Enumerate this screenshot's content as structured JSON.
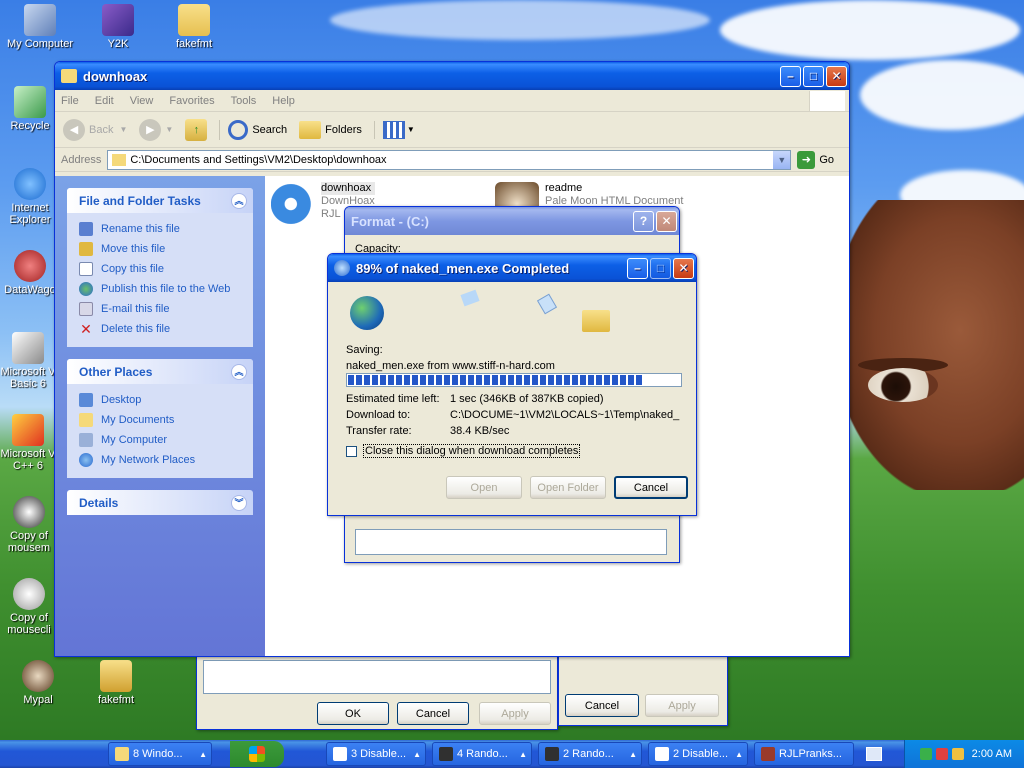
{
  "desktop": {
    "icons": [
      {
        "label": "My Computer"
      },
      {
        "label": "Y2K"
      },
      {
        "label": "fakefmt"
      },
      {
        "label": "Recycle"
      },
      {
        "label": "Internet Explorer"
      },
      {
        "label": "DataWago"
      },
      {
        "label": "Microsoft V Basic 6"
      },
      {
        "label": "Microsoft V C++ 6"
      },
      {
        "label": "Copy of mousem"
      },
      {
        "label": "Copy of mousecli"
      },
      {
        "label": "Mypal"
      },
      {
        "label": "fakefmt"
      }
    ]
  },
  "explorer": {
    "title": "downhoax",
    "menu": [
      "File",
      "Edit",
      "View",
      "Favorites",
      "Tools",
      "Help"
    ],
    "toolbar": {
      "back": "Back",
      "search": "Search",
      "folders": "Folders"
    },
    "address": {
      "label": "Address",
      "value": "C:\\Documents and Settings\\VM2\\Desktop\\downhoax",
      "go": "Go"
    },
    "tasks_panel": {
      "title": "File and Folder Tasks",
      "items": [
        "Rename this file",
        "Move this file",
        "Copy this file",
        "Publish this file to the Web",
        "E-mail this file",
        "Delete this file"
      ]
    },
    "places_panel": {
      "title": "Other Places",
      "items": [
        "Desktop",
        "My Documents",
        "My Computer",
        "My Network Places"
      ]
    },
    "details_panel": {
      "title": "Details"
    },
    "files": [
      {
        "name": "downhoax",
        "line2": "DownHoax",
        "line3": "RJL"
      },
      {
        "name": "readme",
        "line2": "Pale Moon HTML Document"
      }
    ]
  },
  "format_dialog": {
    "title": "Format -  (C:)",
    "capacity_label": "Capacity:",
    "buttons": {
      "ok": "OK",
      "cancel": "Cancel",
      "apply": "Apply"
    }
  },
  "props_dialog": {
    "buttons": {
      "cancel": "Cancel",
      "apply": "Apply"
    }
  },
  "download": {
    "title": "89% of naked_men.exe Completed",
    "progress_percent": 89,
    "saving_label": "Saving:",
    "saving_value": "naked_men.exe from www.stiff-n-hard.com",
    "time_left_label": "Estimated time left:",
    "time_left_value": "1 sec (346KB of 387KB copied)",
    "download_to_label": "Download to:",
    "download_to_value": "C:\\DOCUME~1\\VM2\\LOCALS~1\\Temp\\naked_",
    "rate_label": "Transfer rate:",
    "rate_value": "38.4 KB/sec",
    "checkbox_label": "Close this dialog when download completes",
    "buttons": {
      "open": "Open",
      "open_folder": "Open Folder",
      "cancel": "Cancel"
    }
  },
  "taskbar": {
    "tasks": [
      "8 Windo...",
      "3 Disable...",
      "4 Rando...",
      "2 Rando...",
      "2 Disable...",
      "RJLPranks..."
    ],
    "clock": "2:00 AM"
  }
}
